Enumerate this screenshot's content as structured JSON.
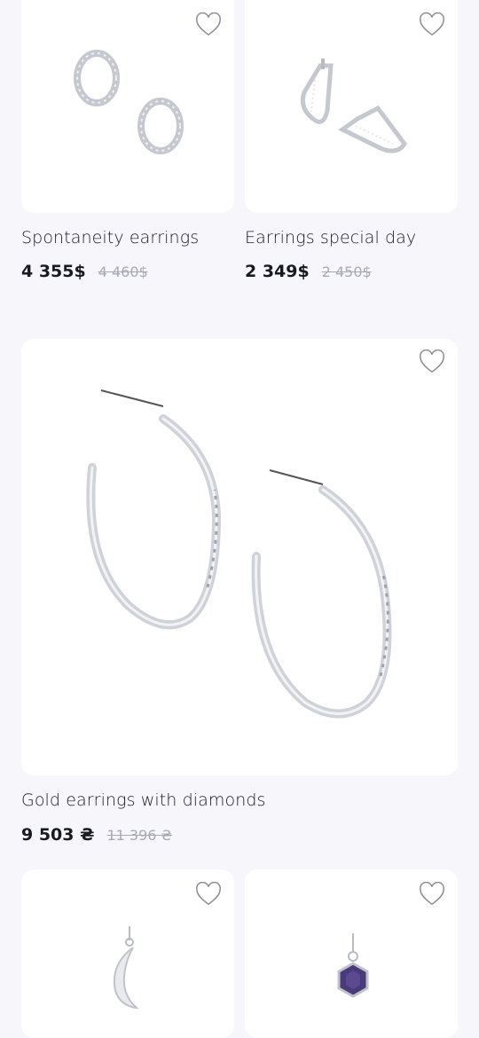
{
  "products": [
    {
      "title": "Spontaneity earrings",
      "price": "4 355$",
      "old_price": "4 460$",
      "favorite_icon": "heart-outline-icon"
    },
    {
      "title": "Earrings special day",
      "price": "2 349$",
      "old_price": "2 450$",
      "favorite_icon": "heart-outline-icon"
    },
    {
      "title": "Gold earrings with diamonds",
      "price": "9 503 ₴",
      "old_price": "11 396 ₴",
      "favorite_icon": "heart-outline-icon"
    },
    {
      "title": "",
      "price": "",
      "old_price": "",
      "favorite_icon": "heart-outline-icon"
    },
    {
      "title": "",
      "price": "",
      "old_price": "",
      "favorite_icon": "heart-outline-icon"
    }
  ],
  "colors": {
    "background": "#f6f6fb",
    "card": "#ffffff",
    "text": "#1a1a22",
    "old_price": "#a9a9b3",
    "silver": "#c9ccd2",
    "amethyst": "#4a3a7a"
  }
}
